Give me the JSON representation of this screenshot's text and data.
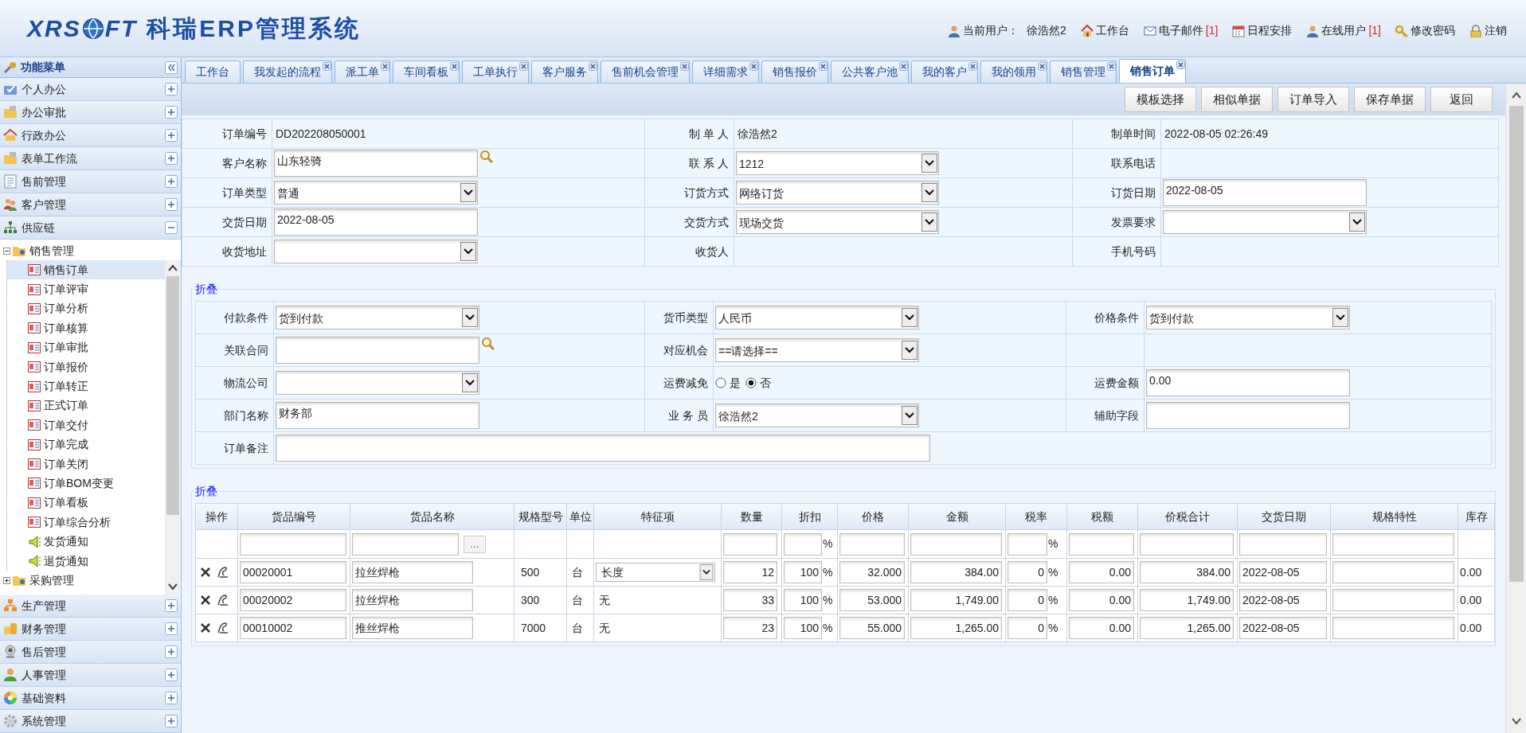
{
  "header": {
    "logo_left": "XRS",
    "logo_right": "FT",
    "title": "科瑞ERP管理系统",
    "links": [
      {
        "label": "当前用户：",
        "value": "徐浩然2"
      },
      {
        "label": "工作台"
      },
      {
        "label": "电子邮件",
        "badge": "[1]"
      },
      {
        "label": "日程安排"
      },
      {
        "label": "在线用户",
        "badge": "[1]"
      },
      {
        "label": "修改密码"
      },
      {
        "label": "注销"
      }
    ]
  },
  "sidebar": {
    "title": "功能菜单",
    "groups": [
      {
        "label": "个人办公",
        "expanded": false
      },
      {
        "label": "办公审批",
        "expanded": false
      },
      {
        "label": "行政办公",
        "expanded": false
      },
      {
        "label": "表单工作流",
        "expanded": false
      },
      {
        "label": "售前管理",
        "expanded": false
      },
      {
        "label": "客户管理",
        "expanded": false
      },
      {
        "label": "供应链",
        "expanded": true,
        "tree": [
          {
            "label": "销售管理",
            "expanded": true,
            "children": [
              {
                "label": "销售订单",
                "kind": "form",
                "selected": true
              },
              {
                "label": "订单评审",
                "kind": "form",
                "selected": false
              },
              {
                "label": "订单分析",
                "kind": "form",
                "selected": false
              },
              {
                "label": "订单核算",
                "kind": "form",
                "selected": false
              },
              {
                "label": "订单审批",
                "kind": "form",
                "selected": false
              },
              {
                "label": "订单报价",
                "kind": "form",
                "selected": false
              },
              {
                "label": "订单转正",
                "kind": "form",
                "selected": false
              },
              {
                "label": "正式订单",
                "kind": "form",
                "selected": false
              },
              {
                "label": "订单交付",
                "kind": "form",
                "selected": false
              },
              {
                "label": "订单完成",
                "kind": "form",
                "selected": false
              },
              {
                "label": "订单关闭",
                "kind": "form",
                "selected": false
              },
              {
                "label": "订单BOM变更",
                "kind": "form",
                "selected": false
              },
              {
                "label": "订单看板",
                "kind": "form",
                "selected": false
              },
              {
                "label": "订单综合分析",
                "kind": "form",
                "selected": false
              },
              {
                "label": "发货通知",
                "kind": "notice",
                "selected": false
              },
              {
                "label": "退货通知",
                "kind": "notice",
                "selected": false
              }
            ]
          },
          {
            "label": "采购管理",
            "expanded": false
          }
        ]
      },
      {
        "label": "生产管理",
        "expanded": false
      },
      {
        "label": "财务管理",
        "expanded": false
      },
      {
        "label": "售后管理",
        "expanded": false
      },
      {
        "label": "人事管理",
        "expanded": false
      },
      {
        "label": "基础资料",
        "expanded": false
      },
      {
        "label": "系统管理",
        "expanded": false
      }
    ]
  },
  "tabs": [
    {
      "label": "工作台",
      "closable": false,
      "selected": false
    },
    {
      "label": "我发起的流程",
      "closable": true,
      "selected": false
    },
    {
      "label": "派工单",
      "closable": true,
      "selected": false
    },
    {
      "label": "车间看板",
      "closable": true,
      "selected": false
    },
    {
      "label": "工单执行",
      "closable": true,
      "selected": false
    },
    {
      "label": "客户服务",
      "closable": true,
      "selected": false
    },
    {
      "label": "售前机会管理",
      "closable": true,
      "selected": false
    },
    {
      "label": "详细需求",
      "closable": true,
      "selected": false
    },
    {
      "label": "销售报价",
      "closable": true,
      "selected": false
    },
    {
      "label": "公共客户池",
      "closable": true,
      "selected": false
    },
    {
      "label": "我的客户",
      "closable": true,
      "selected": false
    },
    {
      "label": "我的领用",
      "closable": true,
      "selected": false
    },
    {
      "label": "销售管理",
      "closable": true,
      "selected": false
    },
    {
      "label": "销售订单",
      "closable": true,
      "selected": true
    }
  ],
  "toolbar": {
    "buttons": [
      "模板选择",
      "相似单据",
      "订单导入",
      "保存单据",
      "返回"
    ]
  },
  "order_form": {
    "rows": [
      [
        {
          "label": "订单编号",
          "kind": "text",
          "value": "DD202208050001"
        },
        {
          "label": "制 单 人",
          "kind": "text",
          "value": "徐浩然2"
        },
        {
          "label": "制单时间",
          "kind": "text",
          "value": "2022-08-05 02:26:49"
        }
      ],
      [
        {
          "label": "客户名称",
          "kind": "lookup",
          "value": "山东轻骑"
        },
        {
          "label": "联 系 人",
          "kind": "select",
          "value": "1212"
        },
        {
          "label": "联系电话",
          "kind": "text"
        }
      ],
      [
        {
          "label": "订单类型",
          "kind": "select",
          "value": "普通"
        },
        {
          "label": "订货方式",
          "kind": "select",
          "value": "网络订货"
        },
        {
          "label": "订货日期",
          "kind": "input",
          "value": "2022-08-05"
        }
      ],
      [
        {
          "label": "交货日期",
          "kind": "input",
          "value": "2022-08-05"
        },
        {
          "label": "交货方式",
          "kind": "select",
          "value": "现场交货"
        },
        {
          "label": "发票要求",
          "kind": "select"
        }
      ],
      [
        {
          "label": "收货地址",
          "kind": "select"
        },
        {
          "label": "收货人",
          "kind": "text"
        },
        {
          "label": "手机号码",
          "kind": "text"
        }
      ]
    ]
  },
  "terms": {
    "legend": "折叠",
    "rows": [
      [
        {
          "label": "付款条件",
          "kind": "select",
          "value": "货到付款"
        },
        {
          "label": "货币类型",
          "kind": "select",
          "value": "人民币"
        },
        {
          "label": "价格条件",
          "kind": "select",
          "value": "货到付款"
        }
      ],
      [
        {
          "label": "关联合同",
          "kind": "lookup"
        },
        {
          "label": "对应机会",
          "kind": "select",
          "value": "==请选择=="
        }
      ],
      [
        {
          "label": "物流公司",
          "kind": "select"
        },
        {
          "label": "运费减免",
          "kind": "radio",
          "options": [
            {
              "label": "是",
              "selected": false
            },
            {
              "label": "否",
              "selected": true
            }
          ]
        },
        {
          "label": "运费金额",
          "kind": "input",
          "value": "0.00"
        }
      ],
      [
        {
          "label": "部门名称",
          "kind": "input",
          "value": "财务部"
        },
        {
          "label": "业 务 员",
          "kind": "select",
          "value": "徐浩然2"
        },
        {
          "label": "辅助字段",
          "kind": "input"
        }
      ],
      [
        {
          "label": "订单备注",
          "kind": "wide_input"
        }
      ]
    ]
  },
  "items": {
    "legend": "折叠",
    "columns": [
      "操作",
      "货品编号",
      "货品名称",
      "规格型号",
      "单位",
      "特征项",
      "数量",
      "折扣",
      "价格",
      "金额",
      "税率",
      "税额",
      "价税合计",
      "交货日期",
      "规格特性",
      "库存"
    ],
    "filter_row": {
      "browse_button": "…",
      "discount_unit": "%",
      "tax_rate_unit": "%"
    },
    "rows": [
      {
        "code": "00020001",
        "name": "拉丝焊枪",
        "spec": "500",
        "unit": "台",
        "feature": {
          "kind": "select",
          "value": "长度"
        },
        "qty": "12",
        "discount": "100",
        "discount_unit": "%",
        "price": "32.000",
        "amount": "384.00",
        "tax_rate": "0",
        "tax_rate_unit": "%",
        "tax": "0.00",
        "total": "384.00",
        "delivery_date": "2022-08-05",
        "stock": "0.00"
      },
      {
        "code": "00020002",
        "name": "拉丝焊枪",
        "spec": "300",
        "unit": "台",
        "feature": {
          "kind": "text",
          "value": "无"
        },
        "qty": "33",
        "discount": "100",
        "discount_unit": "%",
        "price": "53.000",
        "amount": "1,749.00",
        "tax_rate": "0",
        "tax_rate_unit": "%",
        "tax": "0.00",
        "total": "1,749.00",
        "delivery_date": "2022-08-05",
        "stock": "0.00"
      },
      {
        "code": "00010002",
        "name": "推丝焊枪",
        "spec": "7000",
        "unit": "台",
        "feature": {
          "kind": "text",
          "value": "无"
        },
        "qty": "23",
        "discount": "100",
        "discount_unit": "%",
        "price": "55.000",
        "amount": "1,265.00",
        "tax_rate": "0",
        "tax_rate_unit": "%",
        "tax": "0.00",
        "total": "1,265.00",
        "delivery_date": "2022-08-05",
        "stock": "0.00"
      }
    ]
  }
}
